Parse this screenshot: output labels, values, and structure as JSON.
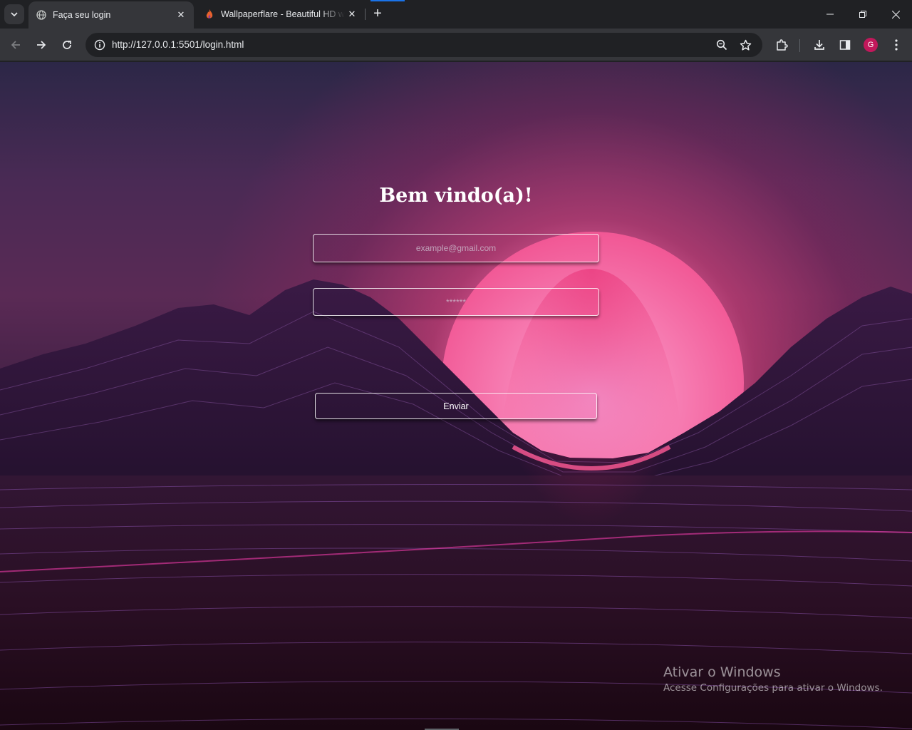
{
  "browser": {
    "tabs": [
      {
        "title": "Faça seu login",
        "active": true,
        "icon": "globe-icon"
      },
      {
        "title": "Wallpaperflare - Beautiful HD w",
        "active": false,
        "icon": "wallpaperflare-flame-icon"
      }
    ],
    "new_tab_symbol": "+",
    "url_host": "http://127.0.0.1",
    "url_rest": ":5501/login.html",
    "profile_initial": "G",
    "accent_color": "#1a73e8",
    "profile_color": "#c2185b"
  },
  "page": {
    "heading": "Bem vindo(a)!",
    "email_placeholder": "example@gmail.com",
    "password_placeholder": "******",
    "submit_label": "Enviar"
  },
  "watermark": {
    "title": "Ativar o Windows",
    "subtitle": "Acesse Configurações para ativar o Windows."
  }
}
